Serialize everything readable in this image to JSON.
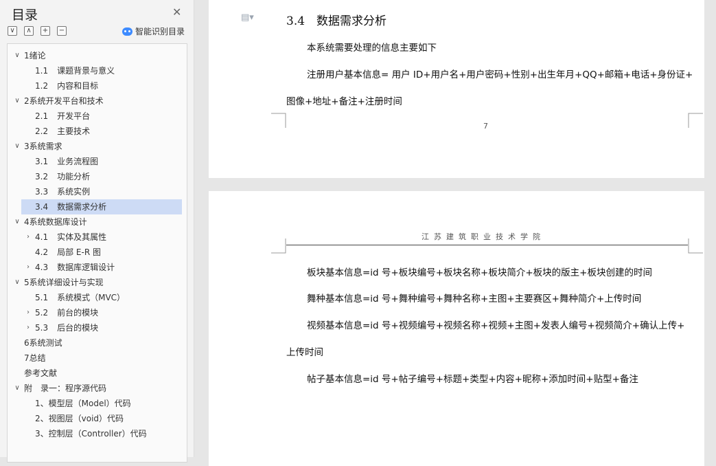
{
  "sidebar": {
    "title": "目录",
    "close_glyph": "✕",
    "tools": [
      "∨",
      "∧",
      "+",
      "−"
    ],
    "smart_label": "智能识别目录",
    "items": [
      {
        "chev": "∨",
        "indent": 0,
        "num": "",
        "label": "1绪论",
        "selected": false
      },
      {
        "chev": "",
        "indent": 1,
        "num": "1.1",
        "label": "课题背景与意义",
        "selected": false
      },
      {
        "chev": "",
        "indent": 1,
        "num": "1.2",
        "label": "内容和目标",
        "selected": false
      },
      {
        "chev": "∨",
        "indent": 0,
        "num": "",
        "label": "2系统开发平台和技术",
        "selected": false
      },
      {
        "chev": "",
        "indent": 1,
        "num": "2.1",
        "label": "开发平台",
        "selected": false
      },
      {
        "chev": "",
        "indent": 1,
        "num": "2.2",
        "label": "主要技术",
        "selected": false
      },
      {
        "chev": "∨",
        "indent": 0,
        "num": "",
        "label": "3系统需求",
        "selected": false
      },
      {
        "chev": "",
        "indent": 1,
        "num": "3.1",
        "label": "业务流程图",
        "selected": false
      },
      {
        "chev": "",
        "indent": 1,
        "num": "3.2",
        "label": "功能分析",
        "selected": false
      },
      {
        "chev": "",
        "indent": 1,
        "num": "3.3",
        "label": "系统实例",
        "selected": false
      },
      {
        "chev": "",
        "indent": 1,
        "num": "3.4",
        "label": "数据需求分析",
        "selected": true
      },
      {
        "chev": "∨",
        "indent": 0,
        "num": "",
        "label": "4系统数据库设计",
        "selected": false
      },
      {
        "chev": "›",
        "indent": 1,
        "num": "4.1",
        "label": "实体及其属性",
        "selected": false
      },
      {
        "chev": "",
        "indent": 1,
        "num": "4.2",
        "label": "局部 E-R 图",
        "selected": false
      },
      {
        "chev": "›",
        "indent": 1,
        "num": "4.3",
        "label": "数据库逻辑设计",
        "selected": false
      },
      {
        "chev": "∨",
        "indent": 0,
        "num": "",
        "label": "5系统详细设计与实现",
        "selected": false
      },
      {
        "chev": "",
        "indent": 1,
        "num": "5.1",
        "label": "系统模式（MVC）",
        "selected": false
      },
      {
        "chev": "›",
        "indent": 1,
        "num": "5.2",
        "label": "前台的模块",
        "selected": false
      },
      {
        "chev": "›",
        "indent": 1,
        "num": "5.3",
        "label": "后台的模块",
        "selected": false
      },
      {
        "chev": "",
        "indent": 0,
        "num": "",
        "label": "6系统测试",
        "selected": false
      },
      {
        "chev": "",
        "indent": 0,
        "num": "",
        "label": "7总结",
        "selected": false
      },
      {
        "chev": "",
        "indent": 0,
        "num": "",
        "label": "参考文献",
        "selected": false
      },
      {
        "chev": "∨",
        "indent": 0,
        "num": "",
        "label": "附　录一：程序源代码",
        "selected": false
      },
      {
        "chev": "",
        "indent": 1,
        "num": "",
        "label": "1、模型层（Model）代码",
        "selected": false
      },
      {
        "chev": "",
        "indent": 1,
        "num": "",
        "label": "2、视图层（void）代码",
        "selected": false
      },
      {
        "chev": "",
        "indent": 1,
        "num": "",
        "label": "3、控制层（Controller）代码",
        "selected": false
      }
    ]
  },
  "doc": {
    "page1": {
      "heading": "3.4　数据需求分析",
      "paragraphs": [
        "本系统需要处理的信息主要如下",
        "注册用户基本信息= 用户 ID+用户名+用户密码+性别+出生年月+QQ+邮箱+电话+身份证+",
        "图像+地址+备注+注册时间"
      ],
      "page_number": "7"
    },
    "page2": {
      "header": "江苏建筑职业技术学院",
      "paragraphs": [
        "板块基本信息=id 号+板块编号+板块名称+板块简介+板块的版主+板块创建的时间",
        "舞种基本信息=id 号+舞种编号+舞种名称+主图+主要赛区+舞种简介+上传时间",
        "视频基本信息=id 号+视频编号+视频名称+视频+主图+发表人编号+视频简介+确认上传+",
        "上传时间",
        "帖子基本信息=id 号+帖子编号+标题+类型+内容+昵称+添加时间+贴型+备注"
      ]
    }
  }
}
